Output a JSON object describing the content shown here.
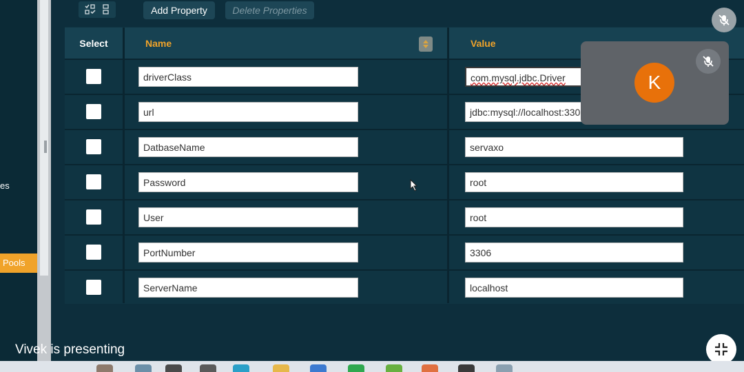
{
  "sidebar": {
    "partial_label": "es",
    "pools_label": "Pools"
  },
  "toolbar": {
    "add_property_label": "Add Property",
    "delete_properties_label": "Delete Properties"
  },
  "table": {
    "columns": [
      "Select",
      "Name",
      "Value"
    ],
    "rows": [
      {
        "name": "driverClass",
        "value": "com.mysql.jdbc.Driver"
      },
      {
        "name": "url",
        "value": "jdbc:mysql://localhost:3306"
      },
      {
        "name": "DatbaseName",
        "value": "servaxo"
      },
      {
        "name": "Password",
        "value": "root"
      },
      {
        "name": "User",
        "value": "root"
      },
      {
        "name": "PortNumber",
        "value": "3306"
      },
      {
        "name": "ServerName",
        "value": "localhost"
      }
    ]
  },
  "meet": {
    "participant_initial": "K",
    "presenting_text": "Vivek is presenting",
    "icons": [
      "mic-off-icon",
      "compress-icon"
    ],
    "avatar_color": "#e8710a"
  },
  "colors": {
    "accent": "#f0a32a",
    "background": "#0d2e3c"
  }
}
